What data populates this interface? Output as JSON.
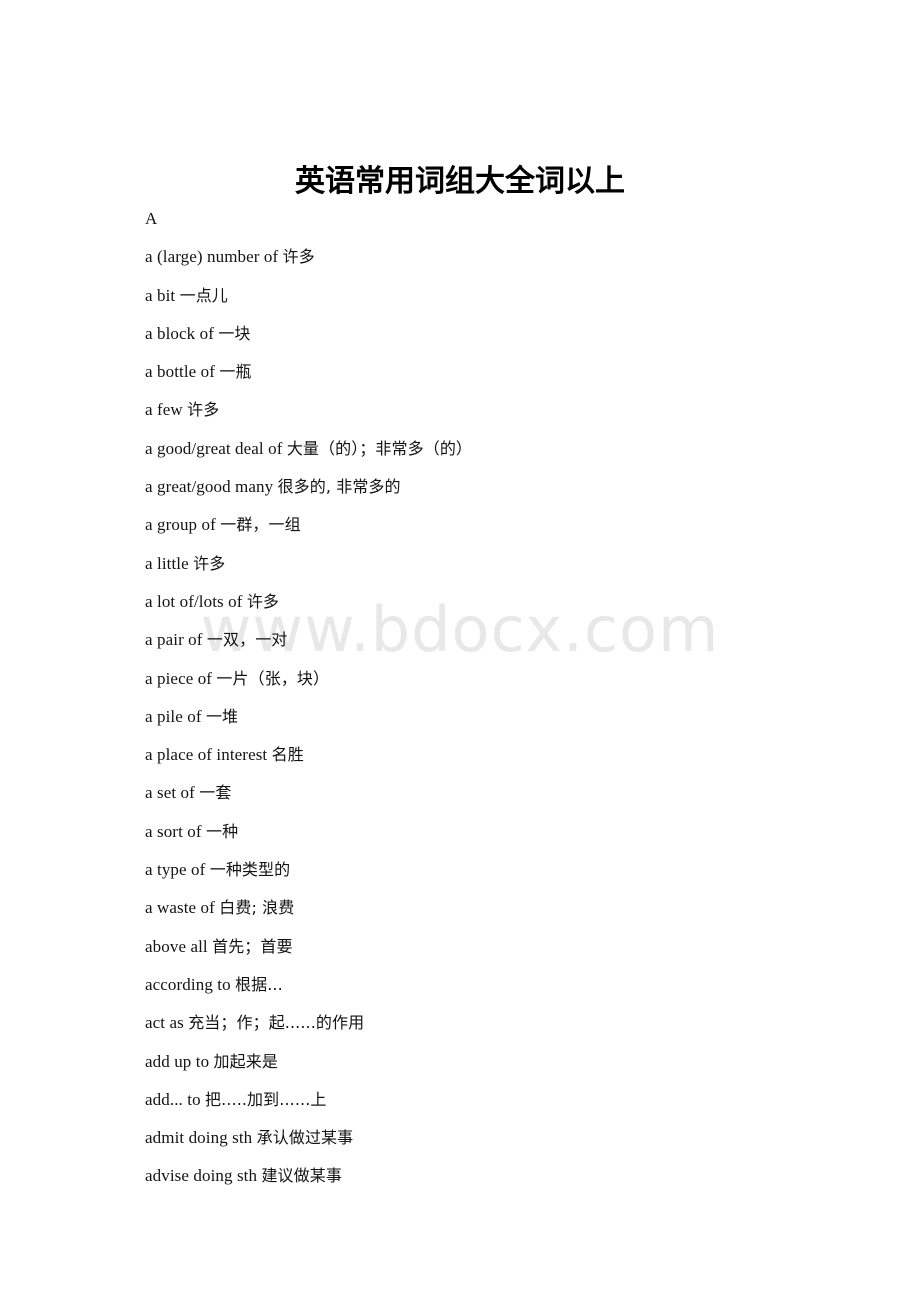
{
  "document": {
    "title": "英语常用词组大全词以上",
    "watermark": "www.bdocx.com",
    "section_letter": "A",
    "entries": [
      {
        "en": "a (large) number of ",
        "cn": "许多"
      },
      {
        "en": "a bit ",
        "cn": "一点儿"
      },
      {
        "en": "a block of ",
        "cn": "一块"
      },
      {
        "en": "a bottle of ",
        "cn": "一瓶"
      },
      {
        "en": "a few ",
        "cn": "许多"
      },
      {
        "en": "a good/great deal of ",
        "cn": "大量（的）；非常多（的）"
      },
      {
        "en": "a great/good many ",
        "cn": "很多的, 非常多的"
      },
      {
        "en": "a group of ",
        "cn": "一群，一组"
      },
      {
        "en": "a little ",
        "cn": "许多"
      },
      {
        "en": "a lot of/lots of ",
        "cn": "许多"
      },
      {
        "en": "a pair of ",
        "cn": "一双，一对"
      },
      {
        "en": "a piece of ",
        "cn": "一片（张，块）"
      },
      {
        "en": "a pile of ",
        "cn": "一堆"
      },
      {
        "en": "a place of interest ",
        "cn": "名胜"
      },
      {
        "en": "a set of ",
        "cn": "一套"
      },
      {
        "en": "a sort of ",
        "cn": "一种"
      },
      {
        "en": "a type of ",
        "cn": "一种类型的"
      },
      {
        "en": "a waste of ",
        "cn": "白费; 浪费"
      },
      {
        "en": "above all ",
        "cn": "首先；首要"
      },
      {
        "en": "according to ",
        "cn": "根据..."
      },
      {
        "en": "act as ",
        "cn": "充当；作；起......的作用"
      },
      {
        "en": "add up to ",
        "cn": "加起来是"
      },
      {
        "en": "add... to ",
        "cn": "把.....加到......上"
      },
      {
        "en": "admit doing sth ",
        "cn": "承认做过某事"
      },
      {
        "en": "advise doing sth ",
        "cn": "建议做某事"
      }
    ]
  }
}
